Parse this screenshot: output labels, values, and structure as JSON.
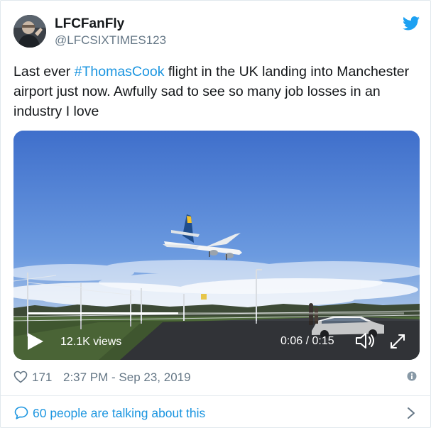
{
  "user": {
    "display_name": "LFCFanFly",
    "handle": "@LFCSIXTIMES123"
  },
  "tweet": {
    "text_before": "Last ever ",
    "hashtag": "#ThomasCook",
    "text_after": " flight in the UK landing into Manchester airport just now. Awfully sad to see so many job losses in an industry I love"
  },
  "video": {
    "views": "12.1K views",
    "time": "0:06 / 0:15",
    "progress": 0.4
  },
  "meta": {
    "likes": "171",
    "datetime": "2:37 PM - Sep 23, 2019"
  },
  "footer": {
    "talking": "60 people are talking about this"
  },
  "icons": {
    "brand": "twitter-bird-icon",
    "like": "heart-icon",
    "info": "info-icon",
    "reply": "speech-bubble-icon",
    "more": "chevron-right-icon"
  },
  "colors": {
    "brand_blue": "#1da1f2",
    "link_blue": "#1b95e0",
    "text": "#14171a",
    "muted": "#657786"
  }
}
